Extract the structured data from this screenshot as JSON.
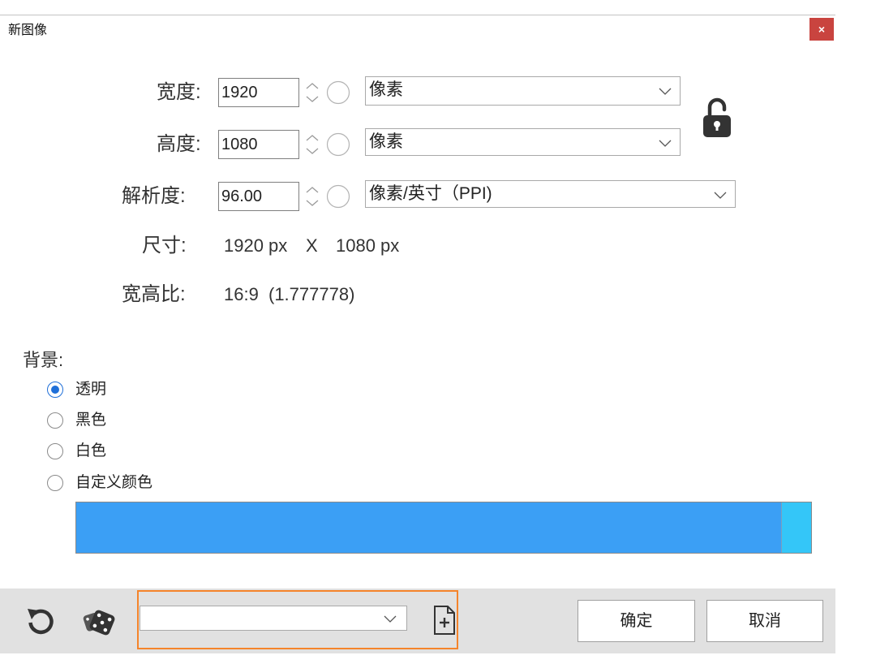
{
  "window": {
    "title": "新图像",
    "close_label": "×"
  },
  "fields": {
    "width": {
      "label": "宽度:",
      "value": "1920",
      "unit": "像素"
    },
    "height": {
      "label": "高度:",
      "value": "1080",
      "unit": "像素"
    },
    "resolution": {
      "label": "解析度:",
      "value": "96.00",
      "unit": "像素/英寸（PPI)"
    },
    "aspect_lock": {
      "icon": "unlock-icon",
      "locked": false
    }
  },
  "size": {
    "label": "尺寸:",
    "width_text": "1920 px",
    "separator": "X",
    "height_text": "1080 px"
  },
  "aspect": {
    "label": "宽高比:",
    "ratio": "16:9",
    "decimal": "(1.777778)"
  },
  "background": {
    "label": "背景:",
    "options": [
      {
        "label": "透明",
        "selected": true
      },
      {
        "label": "黑色",
        "selected": false
      },
      {
        "label": "白色",
        "selected": false
      },
      {
        "label": "自定义颜色",
        "selected": false
      }
    ]
  },
  "toolbar": {
    "ok_label": "确定",
    "cancel_label": "取消",
    "icons": [
      "reset-icon",
      "dice-icon",
      "add-file-icon"
    ]
  },
  "colors": {
    "close_button": "#c9443f",
    "radio_accent": "#1f6fd8",
    "custom_color_main": "#3b9ff5",
    "custom_color_secondary": "#34c6f8",
    "preset_highlight": "#f5842b",
    "toolbar_bg": "#e1e1e1"
  }
}
